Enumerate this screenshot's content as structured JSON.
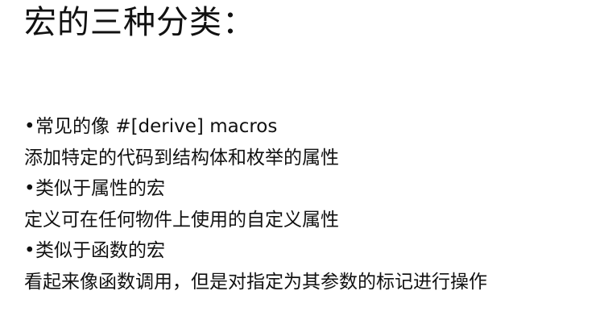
{
  "slide": {
    "title": "宏的三种分类：",
    "lines": [
      {
        "bullet": "•",
        "text": "常见的像 #[derive] macros"
      },
      {
        "bullet": "",
        "text": "添加特定的代码到结构体和枚举的属性"
      },
      {
        "bullet": "•",
        "text": "类似于属性的宏"
      },
      {
        "bullet": "",
        "text": "定义可在任何物件上使用的自定义属性"
      },
      {
        "bullet": "•",
        "text": "类似于函数的宏"
      },
      {
        "bullet": "",
        "text": "看起来像函数调用，但是对指定为其参数的标记进行操作"
      }
    ]
  }
}
